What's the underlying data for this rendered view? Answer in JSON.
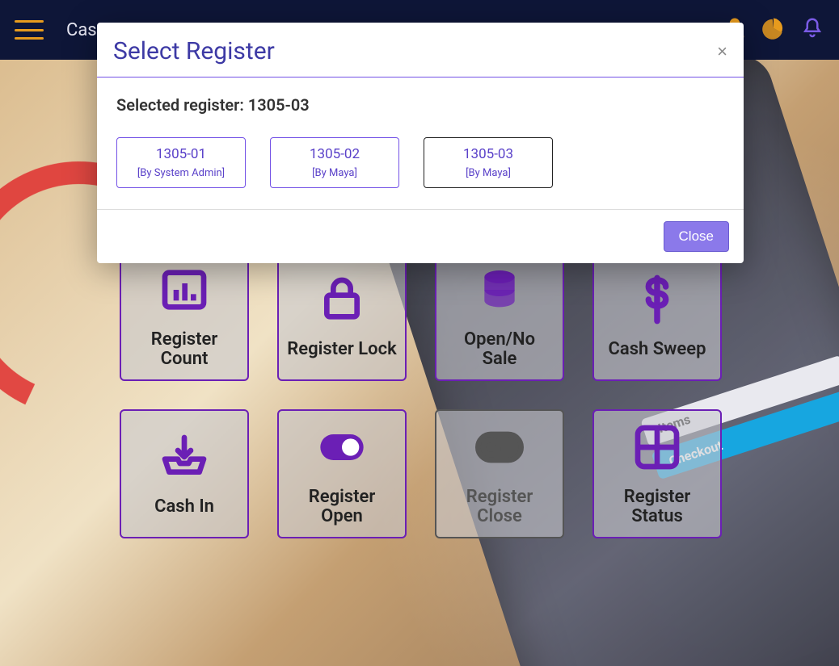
{
  "header": {
    "brand_prefix": "Cas"
  },
  "phone": {
    "items_label": "Items",
    "checkout_label": "Checkout"
  },
  "tiles": [
    {
      "label": "Register Count",
      "disabled": false,
      "icon": "chart"
    },
    {
      "label": "Register Lock",
      "disabled": false,
      "icon": "lock"
    },
    {
      "label": "Open/No Sale",
      "disabled": false,
      "icon": "stack"
    },
    {
      "label": "Cash Sweep",
      "disabled": false,
      "icon": "dollar"
    },
    {
      "label": "Cash In",
      "disabled": false,
      "icon": "inbox"
    },
    {
      "label": "Register Open",
      "disabled": false,
      "icon": "toggle-on"
    },
    {
      "label": "Register Close",
      "disabled": true,
      "icon": "toggle-off"
    },
    {
      "label": "Register Status",
      "disabled": false,
      "icon": "grid"
    }
  ],
  "modal": {
    "title": "Select Register",
    "selected_label_prefix": "Selected register: ",
    "selected_register": "1305-03",
    "registers": [
      {
        "id": "1305-01",
        "by": "[By System Admin]",
        "selected": false
      },
      {
        "id": "1305-02",
        "by": "[By Maya]",
        "selected": false
      },
      {
        "id": "1305-03",
        "by": "[By Maya]",
        "selected": true
      }
    ],
    "close_label": "Close"
  },
  "colors": {
    "accent": "#6b1fb5",
    "topbar": "#0e1638",
    "gold": "#e79b1e"
  }
}
